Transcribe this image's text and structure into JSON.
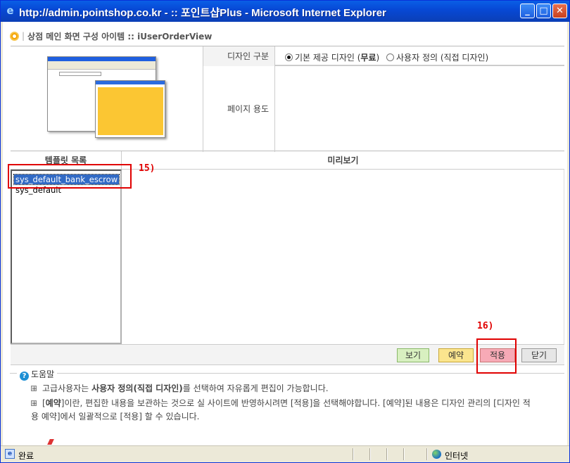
{
  "window": {
    "title": "http://admin.pointshop.co.kr - :: 포인트샵Plus - Microsoft Internet Explorer",
    "minimize": "_",
    "maximize": "□",
    "close": "✕"
  },
  "header": {
    "title": "상점 메인 화면 구성 아이템 :: iUserOrderView"
  },
  "form": {
    "design_label": "디자인 구분",
    "design_options": [
      {
        "label_pre": "기본 제공 디자인 (",
        "label_bold": "무료",
        "label_post": ")",
        "selected": true
      },
      {
        "label": "사용자 정의 (직접 디자인)",
        "selected": false
      }
    ],
    "purpose_label": "페이지 용도"
  },
  "templates": {
    "header": "템플릿 목록",
    "items": [
      "sys_default_bank_escrow",
      "sys_default"
    ],
    "selected_index": 0
  },
  "preview": {
    "header": "미리보기"
  },
  "buttons": {
    "view": "보기",
    "reserve": "예약",
    "apply": "적용",
    "close": "닫기"
  },
  "help": {
    "title": "도움말",
    "line1_pre": "고급사용자는 ",
    "line1_bold": "사용자 정의(직접 디자인)",
    "line1_post": "를 선택하여 자유롭게 편집이 가능합니다.",
    "line2_pre": "[",
    "line2_bold": "예약",
    "line2_post": "]이란, 편집한 내용을 보관하는 것으로 실 사이트에 반영하시려면 [적용]을 선택해야합니다. [예약]된 내용은 디자인 관리의 [디자인 적용 예약]에서 일괄적으로 [적용] 할 수 있습니다."
  },
  "annotations": {
    "label15": "15)",
    "label16": "16)",
    "color": "#e00000"
  },
  "statusbar": {
    "left": "완료",
    "zone": "인터넷"
  },
  "colors": {
    "titlebar": "#0749d6",
    "selection": "#316ac5",
    "thumbnail_accent": "#fbc633"
  }
}
